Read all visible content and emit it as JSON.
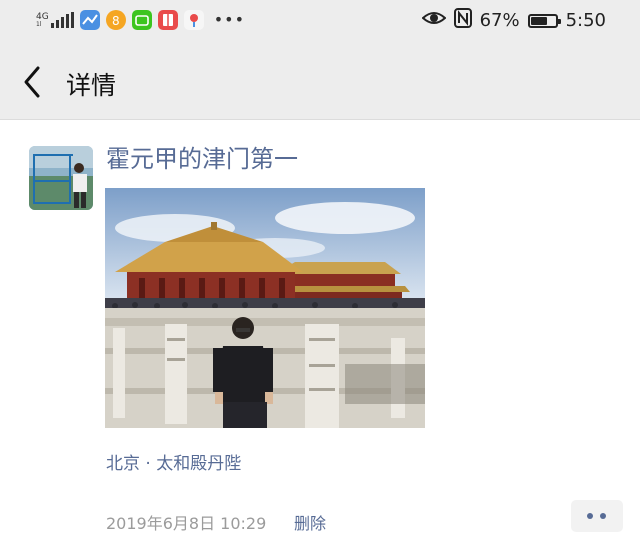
{
  "status_bar": {
    "network": "4G",
    "battery_percent": "67%",
    "battery_level": 0.67,
    "time": "5:50",
    "icons": [
      "signal-icon",
      "app-icon-blue",
      "app-icon-orange",
      "app-icon-green",
      "app-icon-red",
      "app-icon-pin",
      "more-notifications-icon",
      "eye-icon",
      "nfc-icon",
      "battery-icon"
    ]
  },
  "nav": {
    "title": "详情",
    "back_icon": "chevron-left-icon"
  },
  "post": {
    "author": "霍元甲的津门第一",
    "location": "北京 · 太和殿丹陛",
    "timestamp": "2019年6月8日 10:29",
    "delete_label": "删除",
    "more_icon": "more-dots-icon"
  },
  "colors": {
    "link": "#576b95",
    "bar_bg": "#ededed",
    "meta_gray": "#9b9b9b"
  }
}
